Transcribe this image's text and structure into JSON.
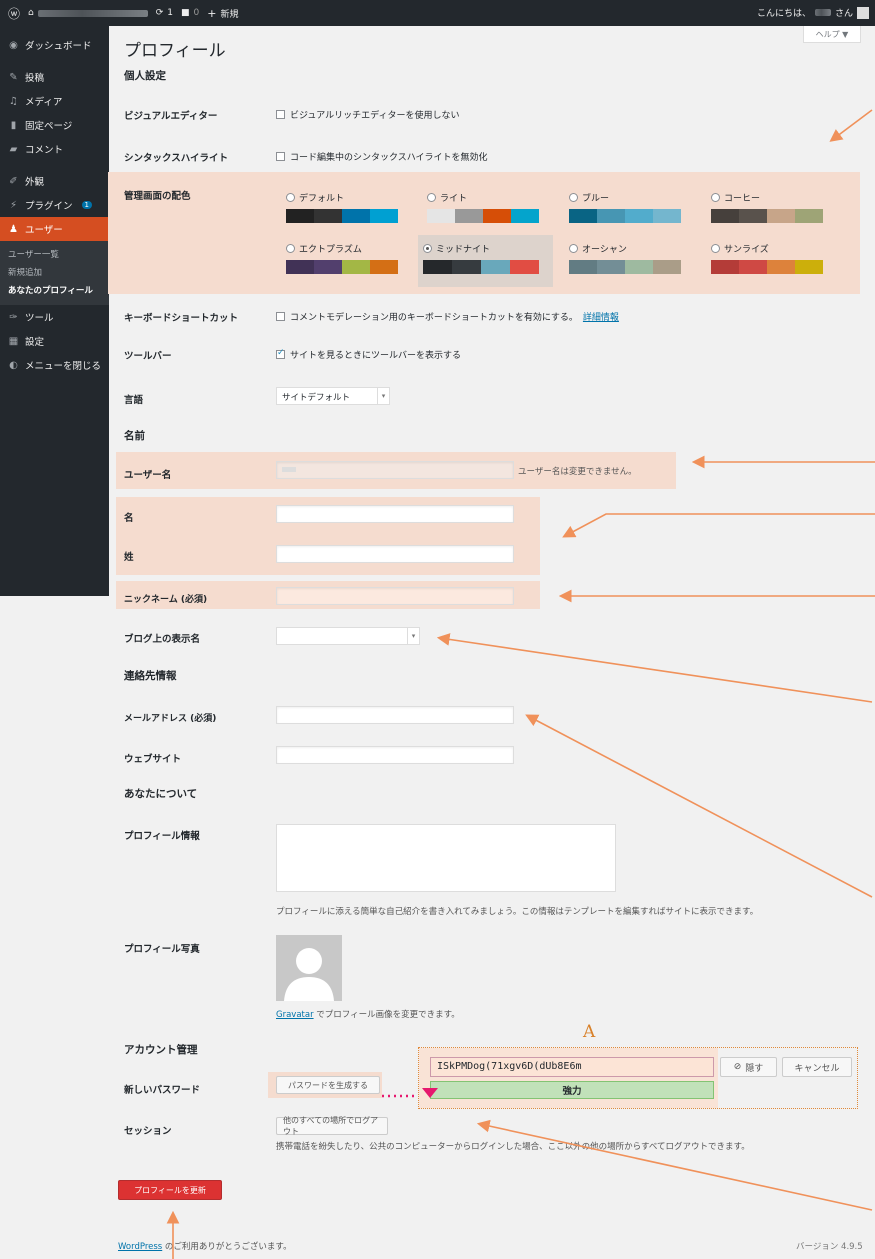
{
  "admin_bar": {
    "comments_count": "1",
    "updates_count": "0",
    "new_label": "新規",
    "greeting": "こんにちは、",
    "greeting_suffix": "さん"
  },
  "help_tab": "ヘルプ ▼",
  "sidebar": {
    "items": [
      {
        "label": "ダッシュボード",
        "icon": "dashboard-icon"
      },
      {
        "label": "投稿",
        "icon": "pin-icon"
      },
      {
        "label": "メディア",
        "icon": "media-icon"
      },
      {
        "label": "固定ページ",
        "icon": "page-icon"
      },
      {
        "label": "コメント",
        "icon": "comment-icon"
      },
      {
        "label": "外観",
        "icon": "brush-icon"
      },
      {
        "label": "プラグイン",
        "icon": "plugin-icon",
        "badge": "1"
      },
      {
        "label": "ユーザー",
        "icon": "user-icon"
      },
      {
        "label": "ツール",
        "icon": "wrench-icon"
      },
      {
        "label": "設定",
        "icon": "settings-icon"
      },
      {
        "label": "メニューを閉じる",
        "icon": "collapse-icon"
      }
    ],
    "submenu": [
      "ユーザー一覧",
      "新規追加",
      "あなたのプロフィール"
    ]
  },
  "page_title": "プロフィール",
  "sections": {
    "personal": "個人設定",
    "name": "名前",
    "contact": "連絡先情報",
    "about": "あなたについて",
    "account": "アカウント管理"
  },
  "fields": {
    "visual_editor": {
      "label": "ビジュアルエディター",
      "option": "ビジュアルリッチエディターを使用しない"
    },
    "syntax": {
      "label": "シンタックスハイライト",
      "option": "コード編集中のシンタックスハイライトを無効化"
    },
    "color_scheme_label": "管理画面の配色",
    "keyboard": {
      "label": "キーボードショートカット",
      "option": "コメントモデレーション用のキーボードショートカットを有効にする。",
      "link": "詳細情報"
    },
    "toolbar": {
      "label": "ツールバー",
      "option": "サイトを見るときにツールバーを表示する"
    },
    "language": {
      "label": "言語",
      "value": "サイトデフォルト"
    },
    "username": {
      "label": "ユーザー名",
      "note": "ユーザー名は変更できません。"
    },
    "first_name": {
      "label": "名"
    },
    "last_name": {
      "label": "姓"
    },
    "nickname": {
      "label": "ニックネーム (必須)"
    },
    "display_name": {
      "label": "ブログ上の表示名"
    },
    "email": {
      "label": "メールアドレス (必須)"
    },
    "website": {
      "label": "ウェブサイト"
    },
    "bio": {
      "label": "プロフィール情報",
      "note": "プロフィールに添える簡単な自己紹介を書き入れてみましょう。この情報はテンプレートを編集すればサイトに表示できます。"
    },
    "photo": {
      "label": "プロフィール写真",
      "gravatar": "Gravatar",
      "note": " でプロフィール画像を変更できます。"
    },
    "new_password": {
      "label": "新しいパスワード",
      "generate": "パスワードを生成する",
      "value": "ISkPMDog(71xgv6D(dUb8E6m",
      "hide": "隠す",
      "cancel": "キャンセル",
      "strength": "強力"
    },
    "sessions": {
      "label": "セッション",
      "button": "他のすべての場所でログアウト",
      "note": "携帯電話を紛失したり、公共のコンピューターからログインした場合、ここ以外の他の場所からすべてログアウトできます。"
    }
  },
  "color_schemes": [
    {
      "name": "デフォルト",
      "selected": false,
      "colors": [
        "#222222",
        "#333333",
        "#0073aa",
        "#00a0d2"
      ]
    },
    {
      "name": "ライト",
      "selected": false,
      "colors": [
        "#e5e5e5",
        "#999999",
        "#d64e07",
        "#04a4cc"
      ]
    },
    {
      "name": "ブルー",
      "selected": false,
      "colors": [
        "#096484",
        "#4796b3",
        "#52accc",
        "#74b6ce"
      ]
    },
    {
      "name": "コーヒー",
      "selected": false,
      "colors": [
        "#46403c",
        "#59524c",
        "#c7a589",
        "#9ea476"
      ]
    },
    {
      "name": "エクトプラズム",
      "selected": false,
      "colors": [
        "#413256",
        "#523f6d",
        "#a3b745",
        "#d46f15"
      ]
    },
    {
      "name": "ミッドナイト",
      "selected": true,
      "colors": [
        "#25282b",
        "#363b3f",
        "#69a8bb",
        "#e14d43"
      ]
    },
    {
      "name": "オーシャン",
      "selected": false,
      "colors": [
        "#627c83",
        "#738e96",
        "#9ebaa0",
        "#aa9d88"
      ]
    },
    {
      "name": "サンライズ",
      "selected": false,
      "colors": [
        "#b43c38",
        "#cf4944",
        "#dd823b",
        "#ccaf0b"
      ]
    }
  ],
  "annotation_letter": "A",
  "submit_button": "プロフィールを更新",
  "footer": {
    "link": "WordPress",
    "text": " のご利用ありがとうございます。",
    "version": "バージョン 4.9.5"
  }
}
